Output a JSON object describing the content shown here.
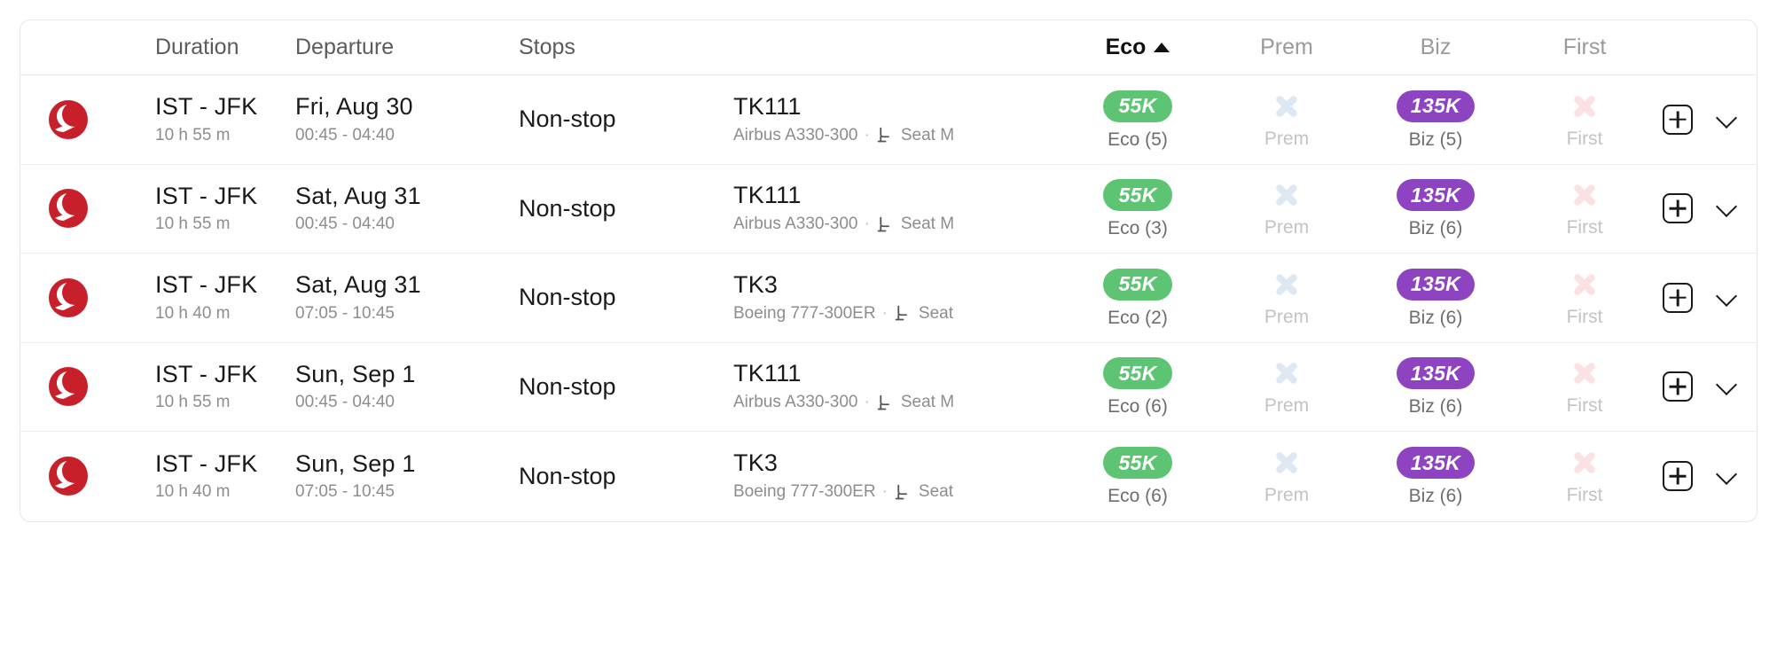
{
  "table": {
    "headers": {
      "logo": "",
      "duration": "Duration",
      "departure": "Departure",
      "stops": "Stops",
      "details": "",
      "eco": "Eco",
      "prem": "Prem",
      "biz": "Biz",
      "first": "First",
      "actions": ""
    },
    "sort": {
      "column": "Eco",
      "direction": "ascending",
      "caret_icon": "caret-up-icon"
    },
    "colors": {
      "eco_pill": "#5cc473",
      "biz_pill": "#8e44c0",
      "prem_unavailable_x": "#dde8f2",
      "first_unavailable_x": "#fbe1e1",
      "airline_logo": "#c8202a"
    },
    "rows": [
      {
        "airline_logo": "turkish-airlines-logo",
        "route": "IST - JFK",
        "duration": "10 h 55 m",
        "date": "Fri, Aug 30",
        "times": "00:45 - 04:40",
        "stops": "Non-stop",
        "flight_number": "TK111",
        "aircraft": "Airbus A330-300",
        "separator": "·",
        "seat_icon": "airplane-seat-icon",
        "seat_label": "Seat M",
        "eco_price": "55K",
        "eco_label": "Eco (5)",
        "prem_available": false,
        "prem_label": "Prem",
        "biz_price": "135K",
        "biz_label": "Biz (5)",
        "first_available": false,
        "first_label": "First",
        "add_icon": "plus-square-icon",
        "expand_icon": "chevron-down-icon"
      },
      {
        "airline_logo": "turkish-airlines-logo",
        "route": "IST - JFK",
        "duration": "10 h 55 m",
        "date": "Sat, Aug 31",
        "times": "00:45 - 04:40",
        "stops": "Non-stop",
        "flight_number": "TK111",
        "aircraft": "Airbus A330-300",
        "separator": "·",
        "seat_icon": "airplane-seat-icon",
        "seat_label": "Seat M",
        "eco_price": "55K",
        "eco_label": "Eco (3)",
        "prem_available": false,
        "prem_label": "Prem",
        "biz_price": "135K",
        "biz_label": "Biz (6)",
        "first_available": false,
        "first_label": "First",
        "add_icon": "plus-square-icon",
        "expand_icon": "chevron-down-icon"
      },
      {
        "airline_logo": "turkish-airlines-logo",
        "route": "IST - JFK",
        "duration": "10 h 40 m",
        "date": "Sat, Aug 31",
        "times": "07:05 - 10:45",
        "stops": "Non-stop",
        "flight_number": "TK3",
        "aircraft": "Boeing 777-300ER",
        "separator": "·",
        "seat_icon": "airplane-seat-icon",
        "seat_label": "Seat",
        "eco_price": "55K",
        "eco_label": "Eco (2)",
        "prem_available": false,
        "prem_label": "Prem",
        "biz_price": "135K",
        "biz_label": "Biz (6)",
        "first_available": false,
        "first_label": "First",
        "add_icon": "plus-square-icon",
        "expand_icon": "chevron-down-icon"
      },
      {
        "airline_logo": "turkish-airlines-logo",
        "route": "IST - JFK",
        "duration": "10 h 55 m",
        "date": "Sun, Sep 1",
        "times": "00:45 - 04:40",
        "stops": "Non-stop",
        "flight_number": "TK111",
        "aircraft": "Airbus A330-300",
        "separator": "·",
        "seat_icon": "airplane-seat-icon",
        "seat_label": "Seat M",
        "eco_price": "55K",
        "eco_label": "Eco (6)",
        "prem_available": false,
        "prem_label": "Prem",
        "biz_price": "135K",
        "biz_label": "Biz (6)",
        "first_available": false,
        "first_label": "First",
        "add_icon": "plus-square-icon",
        "expand_icon": "chevron-down-icon"
      },
      {
        "airline_logo": "turkish-airlines-logo",
        "route": "IST - JFK",
        "duration": "10 h 40 m",
        "date": "Sun, Sep 1",
        "times": "07:05 - 10:45",
        "stops": "Non-stop",
        "flight_number": "TK3",
        "aircraft": "Boeing 777-300ER",
        "separator": "·",
        "seat_icon": "airplane-seat-icon",
        "seat_label": "Seat",
        "eco_price": "55K",
        "eco_label": "Eco (6)",
        "prem_available": false,
        "prem_label": "Prem",
        "biz_price": "135K",
        "biz_label": "Biz (6)",
        "first_available": false,
        "first_label": "First",
        "add_icon": "plus-square-icon",
        "expand_icon": "chevron-down-icon"
      }
    ]
  }
}
